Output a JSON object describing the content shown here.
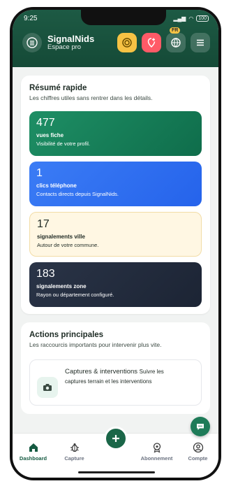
{
  "status": {
    "time": "9:25",
    "battery": "100"
  },
  "header": {
    "brand": "SignalNids",
    "subtitle": "Espace pro",
    "lang_badge": "FR"
  },
  "summary": {
    "title": "Résumé rapide",
    "subtitle": "Les chiffres utiles sans rentrer dans les détails.",
    "stats": [
      {
        "value": "477",
        "label": "vues fiche",
        "desc": "Visibilité de votre profil."
      },
      {
        "value": "1",
        "label": "clics téléphone",
        "desc": "Contacts directs depuis SignalNids."
      },
      {
        "value": "17",
        "label": "signalements ville",
        "desc": "Autour de votre commune."
      },
      {
        "value": "183",
        "label": "signalements zone",
        "desc": "Rayon ou département configuré."
      }
    ]
  },
  "actions": {
    "title": "Actions principales",
    "subtitle": "Les raccourcis importants pour intervenir plus vite.",
    "capture_card": {
      "title": "Captures & interventions",
      "desc_inline": "Suivre les",
      "desc_line2": "captures terrain et les interventions"
    }
  },
  "nav": [
    {
      "label": "Dashboard"
    },
    {
      "label": "Capture"
    },
    {
      "label": ""
    },
    {
      "label": "Abonnement"
    },
    {
      "label": "Compte"
    }
  ],
  "colors": {
    "primary": "#1d5a44",
    "accent_green": "#1e8f65",
    "accent_blue": "#3b7cf5",
    "accent_yellow": "#f6c244",
    "accent_red": "#ff5a67",
    "dark": "#2a3447"
  }
}
